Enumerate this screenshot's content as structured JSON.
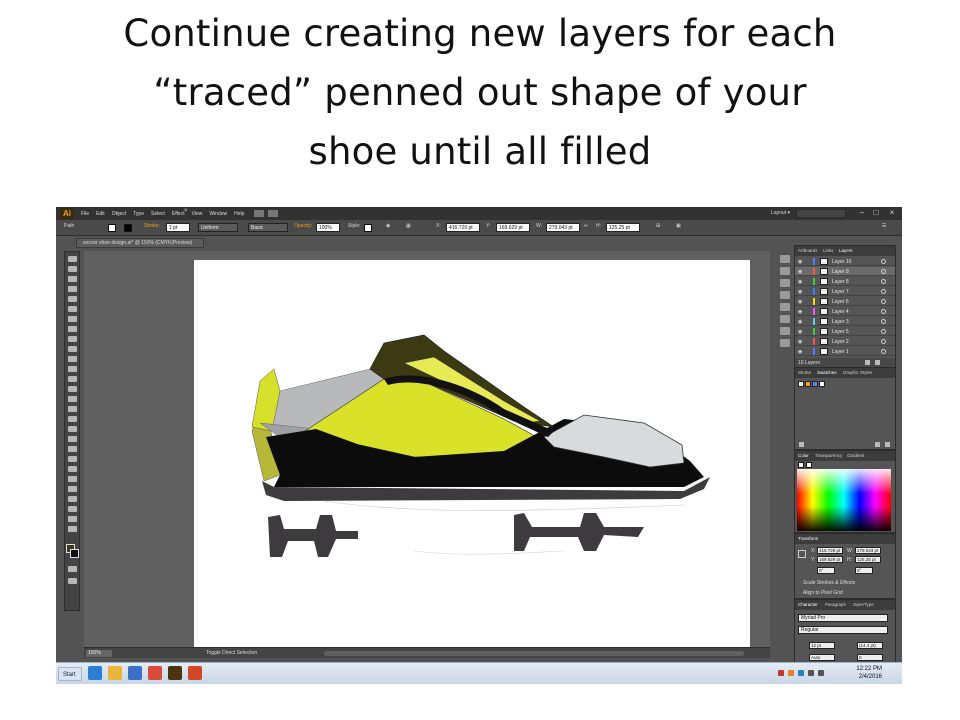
{
  "slide": {
    "title_line1": "Continue creating new layers for each",
    "title_line2": "“traced” penned out shape of your",
    "title_line3": "shoe until all filled"
  },
  "app": {
    "logo": "Ai",
    "menu": [
      "File",
      "Edit",
      "Object",
      "Type",
      "Select",
      "Effect",
      "View",
      "Window",
      "Help"
    ],
    "workspace": "Layout ▾"
  },
  "controlbar": {
    "selection_type": "Path",
    "stroke_label": "Stroke:",
    "stroke_weight": "1 pt",
    "profile": "Uniform",
    "brush": "Basic",
    "opacity_label": "Opacity:",
    "opacity_value": "100%",
    "style_label": "Style:",
    "x_label": "X:",
    "x_value": "416.729 pt",
    "y_label": "Y:",
    "y_value": "169.629 pt",
    "w_label": "W:",
    "w_value": "279.043 pt",
    "h_label": "H:",
    "h_value": "125.25 pt"
  },
  "document": {
    "tab_title": "soccer shoe design.ai* @ 150% (CMYK/Preview)",
    "close_symbol": "×"
  },
  "statusbar": {
    "zoom": "150%",
    "status": "Toggle Direct Selection"
  },
  "layers_panel": {
    "tabs": [
      "Artboards",
      "Links",
      "Layers"
    ],
    "active_tab": "Layers",
    "layers": [
      {
        "name": "Layer 10",
        "color": "#4f7fff",
        "selected": false
      },
      {
        "name": "Layer 9",
        "color": "#ff4f4f",
        "selected": true
      },
      {
        "name": "Layer 8",
        "color": "#3fd13f",
        "selected": false
      },
      {
        "name": "Layer 7",
        "color": "#3f7fff",
        "selected": false
      },
      {
        "name": "Layer 6",
        "color": "#ffd700",
        "selected": false
      },
      {
        "name": "Layer 4",
        "color": "#ff4fff",
        "selected": false
      },
      {
        "name": "Layer 3",
        "color": "#4fd1ff",
        "selected": false
      },
      {
        "name": "Layer 5",
        "color": "#3fd13f",
        "selected": false
      },
      {
        "name": "Layer 2",
        "color": "#ff4f4f",
        "selected": false
      },
      {
        "name": "Layer 1",
        "color": "#4f7fff",
        "selected": false
      }
    ],
    "count": "10 Layers"
  },
  "swatches_panel": {
    "tabs": [
      "Stroke",
      "Swatches",
      "Graphic Styles"
    ],
    "active_tab": "Swatches",
    "swatch_colors": [
      "#ffffff",
      "#f6a623",
      "#4a90e2",
      "#ffffff"
    ]
  },
  "color_panel": {
    "tabs": [
      "Color",
      "Transparency",
      "Gradient"
    ],
    "active_tab": "Color"
  },
  "transform_panel": {
    "title": "Transform",
    "x_label": "X:",
    "x_value": "416.729 pt",
    "y_label": "Y:",
    "y_value": "169.629 pt",
    "w_label": "W:",
    "w_value": "279.043 pt",
    "h_label": "H:",
    "h_value": "125.25 pt",
    "rotate_value": "0°",
    "shear_value": "0°",
    "scale_strokes": "Scale Strokes & Effects",
    "pixel_grid": "Align to Pixel Grid"
  },
  "character_panel": {
    "tabs": [
      "Character",
      "Paragraph",
      "OpenType"
    ],
    "active_tab": "Character",
    "font": "Myriad Pro",
    "style": "Regular",
    "size": "12 pt",
    "leading": "(14.4 pt)",
    "kerning": "Auto",
    "tracking": "0"
  },
  "taskbar": {
    "start_label": "Start",
    "time": "12:22 PM",
    "date": "2/4/2016",
    "apps": [
      {
        "name": "ie",
        "color": "#2a7fd4"
      },
      {
        "name": "explorer",
        "color": "#e8b73a"
      },
      {
        "name": "media",
        "color": "#3c6fc8"
      },
      {
        "name": "chrome",
        "color": "#d84a3a"
      },
      {
        "name": "illustrator",
        "color": "#4a3410"
      },
      {
        "name": "powerpoint",
        "color": "#d24726"
      }
    ]
  }
}
